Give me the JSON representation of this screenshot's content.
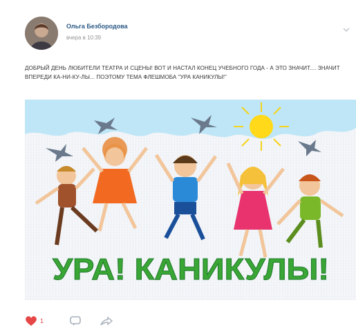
{
  "post": {
    "author": "Ольга Безбородова",
    "time": "вчера в 10:39",
    "text": "ДОБРЫЙ ДЕНЬ ЛЮБИТЕЛИ ТЕАТРА И СЦЕНЫ! ВОТ И НАСТАЛ КОНЕЦ УЧЕБНОГО ГОДА - А ЭТО ЗНАЧИТ.... ЗНАЧИТ ВПЕРЕДИ КА-НИ-КУ-ЛЫ... ПОЭТОМУ ТЕМА ФЛЕШМОБА \"УРА КАНИКУЛЫ!\"",
    "banner_text": "УРА! КАНИКУЛЫ!",
    "likes": "1",
    "icons": {
      "like": "heart-icon",
      "comment": "comment-icon",
      "share": "share-icon",
      "menu": "chevron-down-icon"
    }
  },
  "colors": {
    "author_link": "#2a5885",
    "like": "#e64646",
    "banner_text": "#3aa635",
    "sky": "#bfe6f7"
  }
}
